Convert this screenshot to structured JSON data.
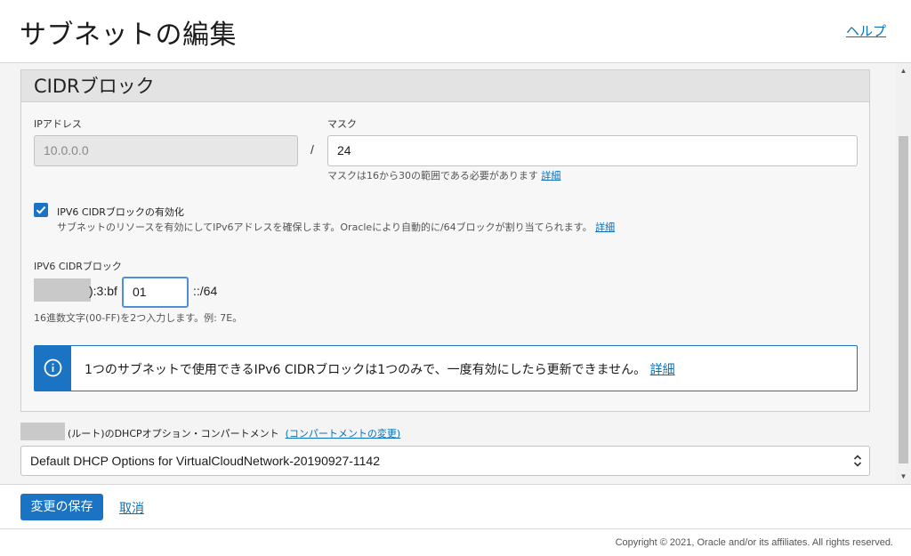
{
  "header": {
    "title": "サブネットの編集",
    "help_label": "ヘルプ"
  },
  "cidr_section": {
    "title": "CIDRブロック",
    "ip_label": "IPアドレス",
    "ip_value": "10.0.0.0",
    "separator": "/",
    "mask_label": "マスク",
    "mask_value": "24",
    "mask_help": "マスクは16から30の範囲である必要があります",
    "mask_help_link": "詳細"
  },
  "ipv6_enable": {
    "checked": true,
    "label": "IPV6 CIDRブロックの有効化",
    "description": "サブネットのリソースを有効にしてIPv6アドレスを確保します。Oracleにより自動的に/64ブロックが割り当てられます。",
    "link": "詳細"
  },
  "ipv6_block": {
    "label": "IPV6 CIDRブロック",
    "prefix_visible": "):3:bf",
    "input_value": "01",
    "suffix": "::/64",
    "help": "16進数文字(00-FF)を2つ入力します。例: 7E。"
  },
  "info_box": {
    "text": "1つのサブネットで使用できるIPv6 CIDRブロックは1つのみで、一度有効にしたら更新できません。",
    "link": "詳細"
  },
  "dhcp": {
    "label_suffix": "(ルート)のDHCPオプション・コンパートメント",
    "change_link": "(コンパートメントの変更)",
    "selected": "Default DHCP Options for VirtualCloudNetwork-20190927-1142"
  },
  "footer": {
    "save_label": "変更の保存",
    "cancel_label": "取消",
    "copyright": "Copyright © 2021, Oracle and/or its affiliates. All rights reserved."
  },
  "colors": {
    "accent": "#1b73c4",
    "link": "#0b6fb8"
  },
  "icons": [
    "info-icon",
    "check-icon",
    "select-arrows-icon"
  ]
}
